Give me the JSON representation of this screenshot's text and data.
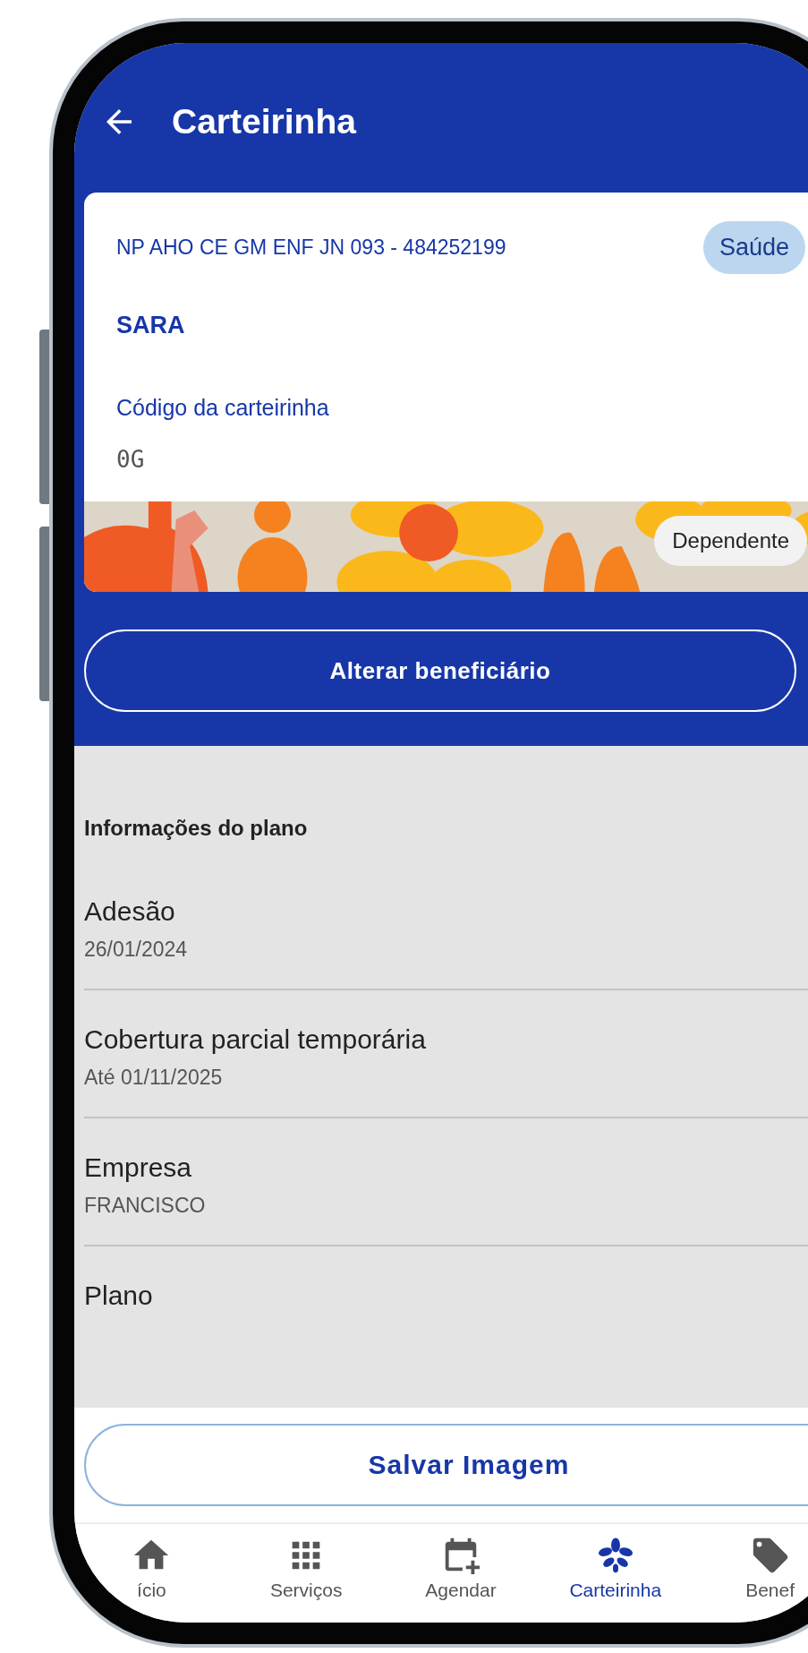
{
  "header": {
    "title": "Carteirinha"
  },
  "card": {
    "plan_code": "NP AHO CE GM ENF JN 093 - 484252199",
    "segment_badge": "Saúde",
    "name": "SARA",
    "code_label": "Código da carteirinha",
    "code_value": "0G",
    "role_badge": "Dependente"
  },
  "change_button": "Alterar beneficiário",
  "plan_info": {
    "title": "Informações do plano",
    "items": [
      {
        "label": "Adesão",
        "value": "26/01/2024"
      },
      {
        "label": "Cobertura parcial temporária",
        "value": "Até 01/11/2025"
      },
      {
        "label": "Empresa",
        "value": "FRANCISCO"
      },
      {
        "label": "Plano"
      }
    ]
  },
  "save_button": "Salvar Imagem",
  "bottom_nav": [
    {
      "label": "ício",
      "kind": "home",
      "selected": false
    },
    {
      "label": "Serviços",
      "kind": "grid",
      "selected": false
    },
    {
      "label": "Agendar",
      "kind": "calendar",
      "selected": false
    },
    {
      "label": "Carteirinha",
      "kind": "flower",
      "selected": true
    },
    {
      "label": "Benef",
      "kind": "tag",
      "selected": false
    }
  ]
}
